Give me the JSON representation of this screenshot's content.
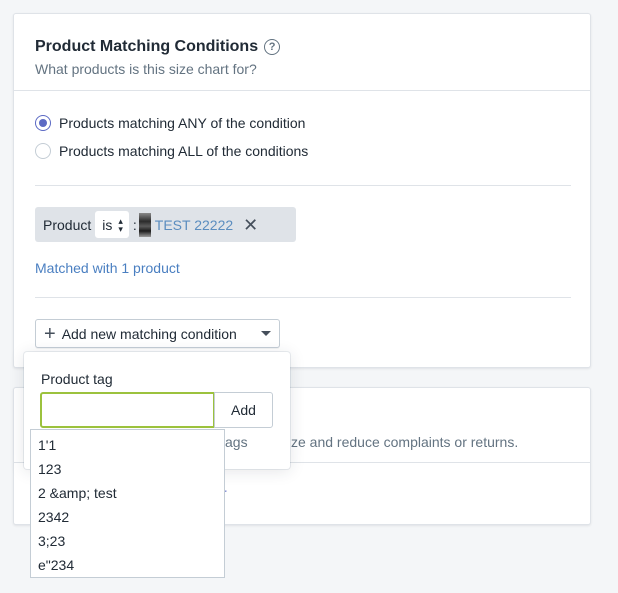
{
  "card": {
    "title": "Product Matching Conditions",
    "help_icon": "?",
    "subtitle": "What products is this size chart for?",
    "radios": [
      {
        "label": "Products matching ANY of the condition",
        "checked": true
      },
      {
        "label": "Products matching ALL of the conditions",
        "checked": false
      }
    ],
    "condition": {
      "field": "Product",
      "operator": "is",
      "separator": ":",
      "value": "TEST 22222",
      "remove_icon": "✕"
    },
    "matched_text": "Matched with 1 product",
    "add_button_label": "Add new matching condition"
  },
  "card2": {
    "partial_text": "ze and reduce complaints or returns.",
    "partial_link": "r"
  },
  "popover": {
    "label": "Product tag",
    "input_value": "",
    "add_label": "Add",
    "peek_text": "ags"
  },
  "dropdown": {
    "items": [
      "1'1",
      "123",
      "2 &amp; test",
      "2342",
      "3;23",
      "e\"234"
    ]
  },
  "colors": {
    "accent": "#5c6ac4",
    "link": "#4a7fc1",
    "input_focus": "#9cc23d",
    "pill_bg": "#dfe3e8"
  }
}
